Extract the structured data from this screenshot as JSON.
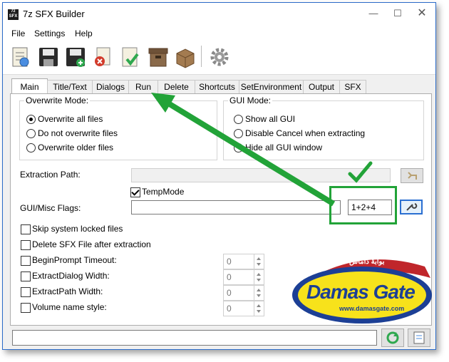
{
  "window": {
    "title": "7z SFX Builder",
    "app_icon_text": "7z SFX"
  },
  "menu": [
    "File",
    "Settings",
    "Help"
  ],
  "tabs": [
    "Main",
    "Title/Text",
    "Dialogs",
    "Run",
    "Delete",
    "Shortcuts",
    "SetEnvironment",
    "Output",
    "SFX"
  ],
  "overwrite": {
    "title": "Overwrite Mode:",
    "options": [
      "Overwrite all files",
      "Do not overwrite files",
      "Overwrite older files"
    ],
    "selected": 0
  },
  "gui_mode": {
    "title": "GUI Mode:",
    "options": [
      "Show all GUI",
      "Disable Cancel when extracting",
      "Hide all GUI window"
    ],
    "selected": -1
  },
  "extraction": {
    "label": "Extraction Path:",
    "value": ""
  },
  "tempmode": {
    "label": "TempMode",
    "checked": true
  },
  "gui_flags": {
    "label": "GUI/Misc Flags:",
    "value": "",
    "flags_value": "1+2+4"
  },
  "checks": [
    {
      "label": "Skip system locked files",
      "checked": false
    },
    {
      "label": "Delete SFX File after extraction",
      "checked": false
    },
    {
      "label": "BeginPrompt Timeout:",
      "checked": false,
      "spin": "0"
    },
    {
      "label": "ExtractDialog Width:",
      "checked": false,
      "spin": "0"
    },
    {
      "label": "ExtractPath Width:",
      "checked": false,
      "spin": "0"
    },
    {
      "label": "Volume name style:",
      "checked": false,
      "spin": "0"
    }
  ],
  "status": {
    "value": ""
  },
  "watermark": {
    "brand": "Damas Gate",
    "url": "www.damasgate.com",
    "arabic": "بوابة داماس"
  },
  "colors": {
    "annotation_green": "#22a338",
    "accent_blue": "#2a6fd1",
    "logo_yellow": "#f7e21b",
    "logo_blue": "#1c3f95"
  }
}
